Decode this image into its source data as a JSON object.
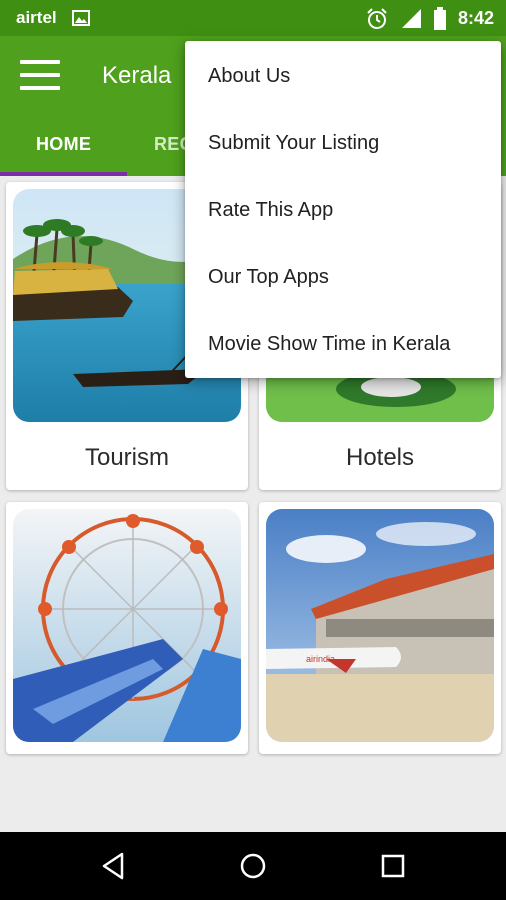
{
  "status_bar": {
    "carrier": "airtel",
    "time": "8:42",
    "icons": [
      "image-icon",
      "alarm-icon",
      "signal-icon",
      "battery-icon"
    ]
  },
  "app_bar": {
    "title": "Kerala",
    "menu_icon": "hamburger-menu-icon",
    "color": "#4fa11d"
  },
  "tabs": [
    {
      "label": "HOME",
      "selected": true
    },
    {
      "label": "REC",
      "selected": false
    }
  ],
  "tab_indicator_color": "#7a2ea8",
  "grid": [
    {
      "label": "Tourism",
      "image": "houseboat-backwaters-image"
    },
    {
      "label": "Hotels",
      "image": "hotel-image"
    },
    {
      "label": "",
      "image": "ferris-wheel-water-park-image"
    },
    {
      "label": "",
      "image": "airport-airplane-image"
    }
  ],
  "overflow_menu": {
    "items": [
      {
        "label": "About Us"
      },
      {
        "label": "Submit Your Listing"
      },
      {
        "label": "Rate This App"
      },
      {
        "label": "Our Top Apps"
      },
      {
        "label": "Movie Show Time in Kerala"
      }
    ]
  },
  "nav_bar": {
    "buttons": [
      "back-icon",
      "home-icon",
      "recents-icon"
    ]
  }
}
